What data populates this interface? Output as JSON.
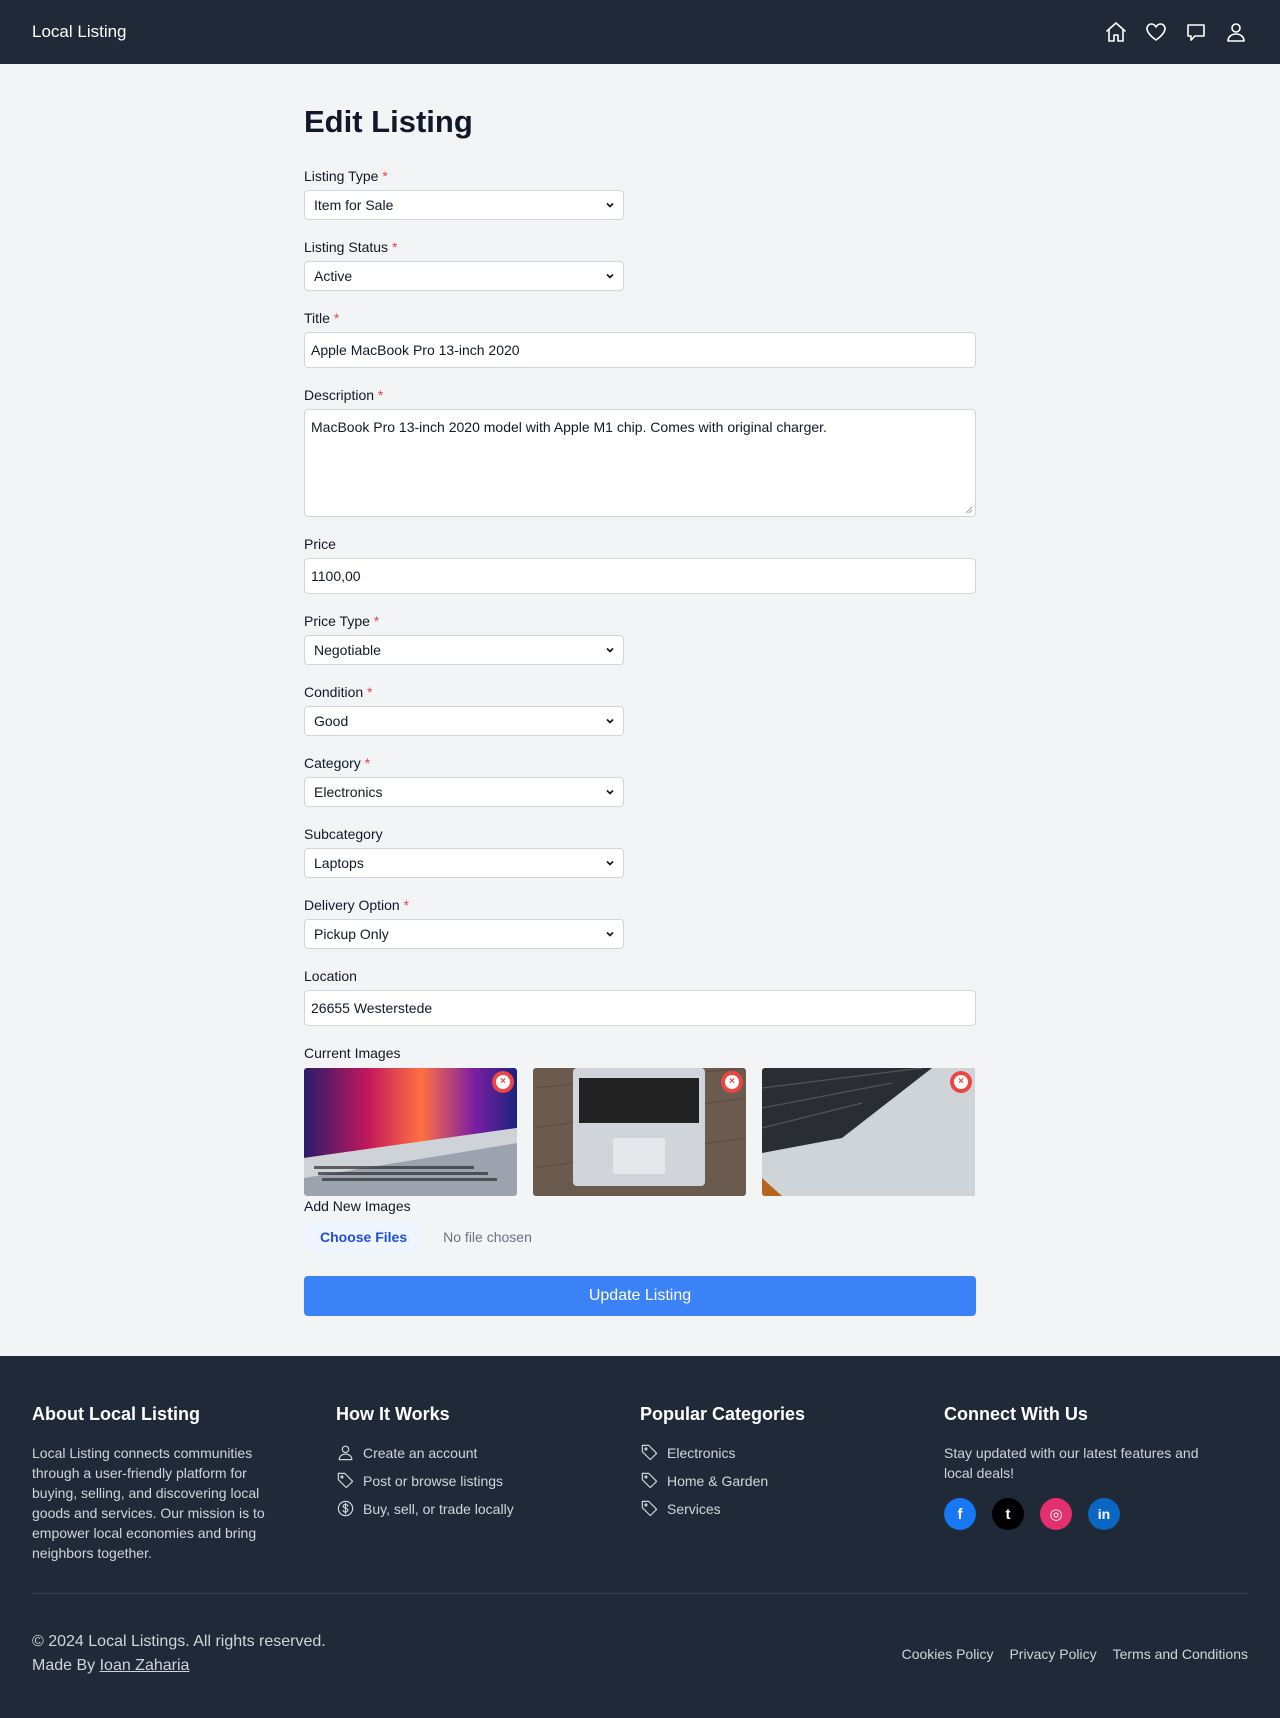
{
  "header": {
    "brand": "Local Listing",
    "icons": [
      "home-icon",
      "heart-icon",
      "chat-icon",
      "user-icon"
    ]
  },
  "page_title": "Edit Listing",
  "form": {
    "listing_type": {
      "label": "Listing Type",
      "required": "*",
      "value": "Item for Sale"
    },
    "listing_status": {
      "label": "Listing Status",
      "required": "*",
      "value": "Active"
    },
    "title": {
      "label": "Title",
      "required": "*",
      "value": "Apple MacBook Pro 13-inch 2020"
    },
    "description": {
      "label": "Description",
      "required": "*",
      "value": "MacBook Pro 13-inch 2020 model with Apple M1 chip. Comes with original charger."
    },
    "price": {
      "label": "Price",
      "value": "1100,00"
    },
    "price_type": {
      "label": "Price Type",
      "required": "*",
      "value": "Negotiable"
    },
    "condition": {
      "label": "Condition",
      "required": "*",
      "value": "Good"
    },
    "category": {
      "label": "Category",
      "required": "*",
      "value": "Electronics"
    },
    "subcategory": {
      "label": "Subcategory",
      "value": "Laptops"
    },
    "delivery_option": {
      "label": "Delivery Option",
      "required": "*",
      "value": "Pickup Only"
    },
    "location": {
      "label": "Location",
      "value": "26655 Westerstede"
    },
    "current_images_label": "Current Images",
    "remove_glyph": "×",
    "add_images_label": "Add New Images",
    "choose_files": "Choose Files",
    "file_status": "No file chosen",
    "submit": "Update Listing"
  },
  "footer": {
    "about": {
      "heading": "About Local Listing",
      "text": "Local Listing connects communities through a user-friendly platform for buying, selling, and discovering local goods and services. Our mission is to empower local economies and bring neighbors together."
    },
    "how": {
      "heading": "How It Works",
      "items": [
        {
          "label": "Create an account",
          "icon": "user-icon"
        },
        {
          "label": "Post or browse listings",
          "icon": "tag-icon"
        },
        {
          "label": "Buy, sell, or trade locally",
          "icon": "dollar-icon"
        }
      ]
    },
    "categories": {
      "heading": "Popular Categories",
      "items": [
        {
          "label": "Electronics",
          "icon": "tag-icon"
        },
        {
          "label": "Home & Garden",
          "icon": "tag-icon"
        },
        {
          "label": "Services",
          "icon": "tag-icon"
        }
      ]
    },
    "connect": {
      "heading": "Connect With Us",
      "text": "Stay updated with our latest features and local deals!",
      "socials": [
        {
          "name": "facebook-icon",
          "glyph": "f",
          "color": "#1877f2"
        },
        {
          "name": "twitter-icon",
          "glyph": "t",
          "color": "#000000"
        },
        {
          "name": "instagram-icon",
          "glyph": "◎",
          "color": "#e1306c"
        },
        {
          "name": "linkedin-icon",
          "glyph": "in",
          "color": "#0a66c2"
        }
      ]
    },
    "copyright": "© 2024 Local Listings. All rights reserved.",
    "made_by_prefix": "Made By",
    "made_by_name": "Ioan Zaharia",
    "legal": [
      "Cookies Policy",
      "Privacy Policy",
      "Terms and Conditions"
    ]
  }
}
